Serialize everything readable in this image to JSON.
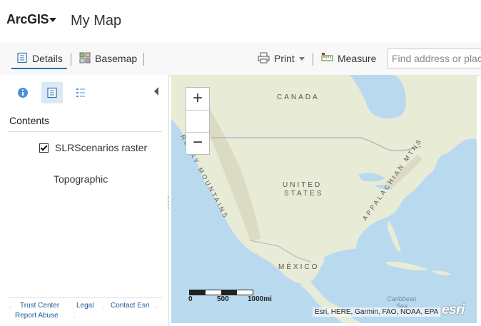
{
  "header": {
    "app_name": "ArcGIS",
    "map_title": "My Map"
  },
  "toolbar": {
    "details_label": "Details",
    "basemap_label": "Basemap",
    "print_label": "Print",
    "measure_label": "Measure",
    "search_placeholder": "Find address or place"
  },
  "panel": {
    "icons": [
      "info-icon",
      "contents-icon",
      "legend-icon"
    ],
    "contents_title": "Contents",
    "layers": [
      {
        "label": "SLRScenarios raster",
        "checked": true
      }
    ],
    "basemap_label": "Topographic",
    "footer_links": [
      "Trust Center",
      "Legal",
      "Contact Esri",
      "Report Abuse"
    ]
  },
  "map": {
    "labels": {
      "canada": "CANADA",
      "united": "UNITED",
      "states": "STATES",
      "mexico": "MÉXICO",
      "rocky": "ROCKY MOUNTAINS",
      "appalachian": "APPALACHIAN MTNS",
      "caribbean": "Caribbean Sea"
    },
    "zoom_in": "+",
    "zoom_out": "−",
    "scale": {
      "zero": "0",
      "mid": "500",
      "end": "1000mi"
    },
    "attribution": "Esri, HERE, Garmin, FAO, NOAA, EPA",
    "logo": "esri"
  },
  "colors": {
    "accent": "#2a6fb0",
    "water": "#b9d9ef",
    "land": "#e9ecd9"
  }
}
